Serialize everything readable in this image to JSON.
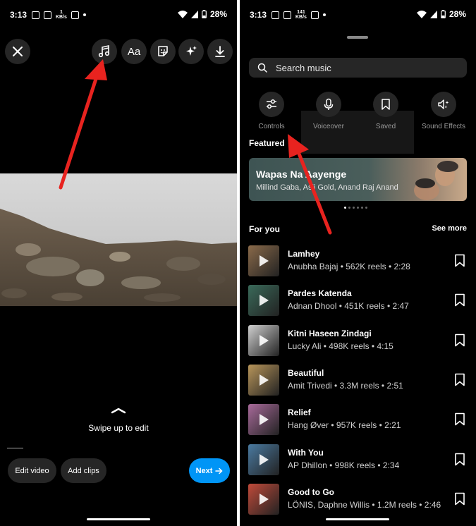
{
  "left": {
    "status": {
      "time": "3:13",
      "speed": "1\nKB/s",
      "battery": "28%"
    },
    "top_tools": [
      "close-icon",
      "music-icon",
      "text-icon",
      "sticker-icon",
      "effects-icon",
      "download-icon"
    ],
    "text_tool_label": "Aa",
    "swipe_text": "Swipe up to edit",
    "edit_video_label": "Edit video",
    "add_clips_label": "Add clips",
    "next_label": "Next"
  },
  "right": {
    "status": {
      "time": "3:13",
      "speed": "141\nKB/s",
      "battery": "28%"
    },
    "search_placeholder": "Search music",
    "tools": [
      {
        "label": "Controls",
        "icon": "sliders-icon"
      },
      {
        "label": "Voiceover",
        "icon": "microphone-icon"
      },
      {
        "label": "Saved",
        "icon": "bookmark-icon"
      },
      {
        "label": "Sound Effects",
        "icon": "sound-effects-icon"
      }
    ],
    "featured_title": "Featured",
    "featured_card": {
      "title": "Wapas Na Aayenge",
      "artists": "Millind Gaba, Asli Gold, Anand Raj Anand"
    },
    "carousel_dots": 6,
    "carousel_active": 0,
    "for_you_title": "For you",
    "see_more_label": "See more",
    "tracks": [
      {
        "title": "Lamhey",
        "meta": "Anubha Bajaj • 562K reels • 2:28",
        "thumb": "#8a6a4a"
      },
      {
        "title": "Pardes Katenda",
        "meta": "Adnan Dhool • 451K reels • 2:47",
        "thumb": "#3a6a5a"
      },
      {
        "title": "Kitni Haseen Zindagi",
        "meta": "Lucky Ali • 498K reels • 4:15",
        "thumb": "#cfcfcf"
      },
      {
        "title": "Beautiful",
        "meta": "Amit Trivedi • 3.3M reels • 2:51",
        "thumb": "#b8955a"
      },
      {
        "title": "Relief",
        "meta": "Hang Øver • 957K reels • 2:21",
        "thumb": "#a86a9a"
      },
      {
        "title": "With You",
        "meta": "AP Dhillon • 998K reels • 2:34",
        "thumb": "#4a7aa0"
      },
      {
        "title": "Good to Go",
        "meta": "LÖNIS, Daphne Willis • 1.2M reels • 2:46",
        "thumb": "#c04a3a"
      }
    ]
  },
  "colors": {
    "accent_blue": "#0095f6",
    "annotation_red": "#e8231f",
    "panel": "#262626"
  }
}
